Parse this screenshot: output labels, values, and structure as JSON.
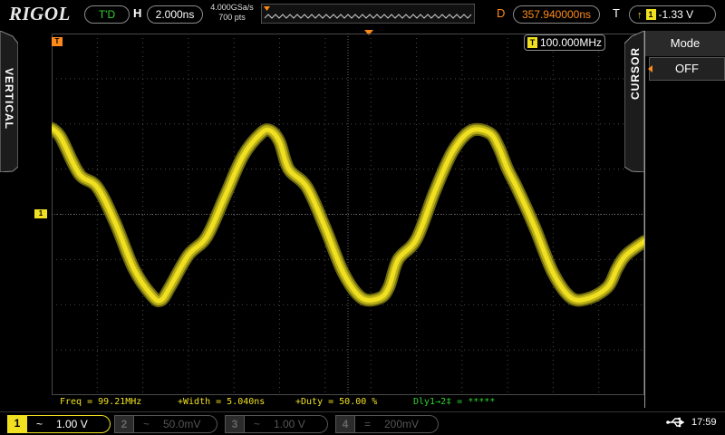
{
  "brand": "RIGOL",
  "colors": {
    "channel1": "#f0e020",
    "trigger": "#ff8a1a",
    "status": "#2fd12f",
    "grid": "#4a4a4a"
  },
  "top": {
    "status": "T'D",
    "h_label": "H",
    "timebase": "2.000ns",
    "sample_rate": "4.000GSa/s",
    "mem_depth": "700 pts",
    "delay_label": "D",
    "delay": "357.940000ns",
    "trigger_label": "T",
    "trigger_edge_icon": "rising-edge-icon",
    "trigger_channel": "1",
    "trigger_level": "-1.33 V"
  },
  "left_tab": {
    "label": "VERTICAL"
  },
  "plot": {
    "trigger_marker": "T",
    "ch1_marker": "1",
    "bandwidth_channel": "T",
    "bandwidth": "100.000MHz"
  },
  "menu": {
    "title": "CURSOR",
    "item_label": "Mode",
    "item_value": "OFF"
  },
  "measurements": [
    {
      "text": "Freq = 99.21MHz",
      "color": "#f0e020"
    },
    {
      "text": "+Width = 5.040ns",
      "color": "#f0e020"
    },
    {
      "text": "+Duty = 50.00 %",
      "color": "#f0e020"
    },
    {
      "text": "Dly1→2‡ = *****",
      "color": "#2fd12f"
    }
  ],
  "channels": [
    {
      "num": "1",
      "coupling": "~",
      "scale": "1.00 V",
      "active": true
    },
    {
      "num": "2",
      "coupling": "~",
      "scale": "50.0mV",
      "active": false
    },
    {
      "num": "3",
      "coupling": "~",
      "scale": "1.00 V",
      "active": false
    },
    {
      "num": "4",
      "coupling": "=",
      "scale": "200mV",
      "active": false
    }
  ],
  "clock": "17:59",
  "chart_data": {
    "type": "line",
    "grid": true,
    "x_divisions": 13,
    "y_divisions": 8,
    "series": [
      {
        "x_div": [
          0,
          0.2,
          0.6,
          1.0,
          1.4,
          1.8,
          2.2,
          2.4,
          2.6,
          3.0,
          3.4,
          3.8,
          4.2,
          4.6,
          4.8,
          5.0,
          5.2,
          5.6,
          6.0,
          6.4,
          6.8,
          7.2,
          7.4,
          7.6,
          8.0,
          8.4,
          8.8,
          9.2,
          9.6,
          9.8,
          10.0,
          10.2,
          10.6,
          11.0,
          11.4,
          11.8,
          12.2,
          12.4,
          12.6,
          13.0
        ],
        "y_div": [
          1.9,
          1.7,
          0.9,
          0.6,
          -0.2,
          -1.2,
          -1.8,
          -1.9,
          -1.6,
          -0.9,
          -0.5,
          0.4,
          1.3,
          1.8,
          1.85,
          1.6,
          1.0,
          0.6,
          -0.3,
          -1.3,
          -1.85,
          -1.85,
          -1.6,
          -1.0,
          -0.55,
          0.5,
          1.4,
          1.85,
          1.8,
          1.5,
          1.0,
          0.6,
          -0.3,
          -1.3,
          -1.85,
          -1.85,
          -1.6,
          -1.2,
          -0.9,
          -0.6
        ]
      }
    ]
  }
}
